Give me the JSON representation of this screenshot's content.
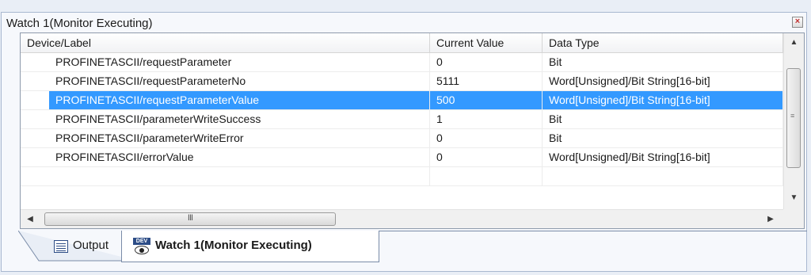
{
  "window": {
    "title": "Watch 1(Monitor Executing)",
    "close_glyph": "×"
  },
  "grid": {
    "columns": {
      "device": "Device/Label",
      "value": "Current Value",
      "type": "Data Type"
    },
    "rows": [
      {
        "device": "PROFINETASCII/requestParameter",
        "value": "0",
        "type": "Bit",
        "selected": false
      },
      {
        "device": "PROFINETASCII/requestParameterNo",
        "value": "5111",
        "type": "Word[Unsigned]/Bit String[16-bit]",
        "selected": false
      },
      {
        "device": "PROFINETASCII/requestParameterValue",
        "value": "500",
        "type": "Word[Unsigned]/Bit String[16-bit]",
        "selected": true
      },
      {
        "device": "PROFINETASCII/parameterWriteSuccess",
        "value": "1",
        "type": "Bit",
        "selected": false
      },
      {
        "device": "PROFINETASCII/parameterWriteError",
        "value": "0",
        "type": "Bit",
        "selected": false
      },
      {
        "device": "PROFINETASCII/errorValue",
        "value": "0",
        "type": "Word[Unsigned]/Bit String[16-bit]",
        "selected": false
      },
      {
        "device": "",
        "value": "",
        "type": "",
        "selected": false
      }
    ],
    "hscroll_grip": "III",
    "vscroll_grip": "≡"
  },
  "tabs": {
    "output": "Output",
    "watch": "Watch 1(Monitor Executing)",
    "dev_badge": "DEV"
  },
  "colors": {
    "selection": "#3399ff",
    "panel": "#e9eef6"
  }
}
